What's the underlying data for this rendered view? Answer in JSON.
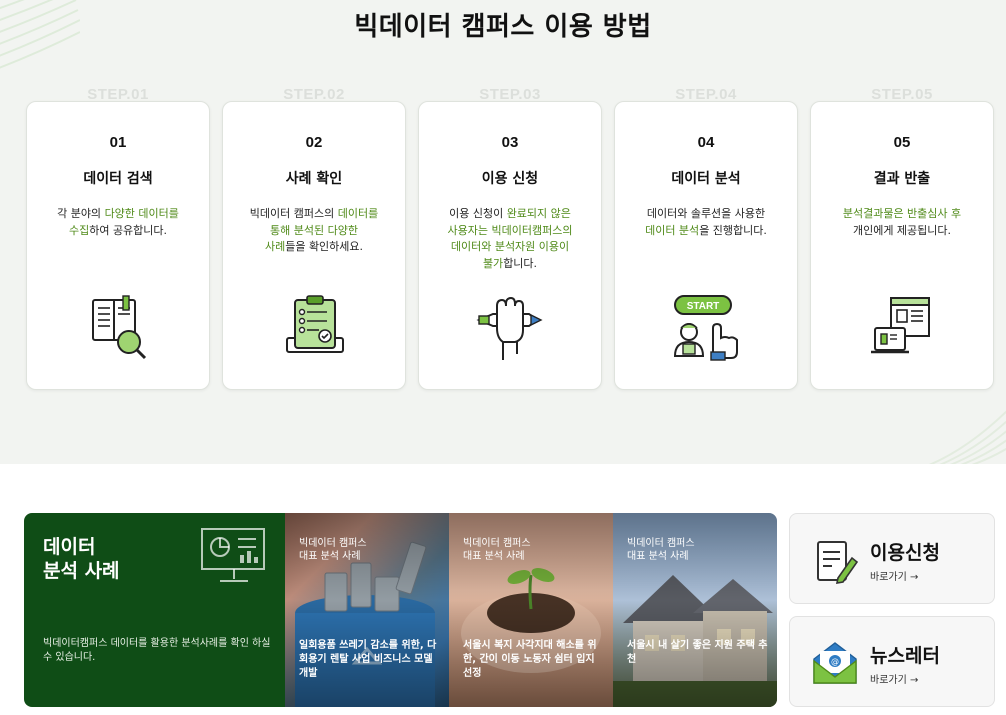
{
  "page": {
    "title": "빅데이터 캠퍼스 이용 방법"
  },
  "steps": [
    {
      "label": "STEP.01",
      "number": "01",
      "name": "데이터 검색",
      "icon": "book-search-icon",
      "desc": [
        [
          {
            "t": "각 분야의 "
          },
          {
            "t": "다양한 데이터를",
            "g": true
          }
        ],
        [
          {
            "t": "수집",
            "g": true
          },
          {
            "t": "하여 공유합니다."
          }
        ]
      ]
    },
    {
      "label": "STEP.02",
      "number": "02",
      "name": "사례 확인",
      "icon": "clipboard-checklist-icon",
      "desc": [
        [
          {
            "t": "빅데이터 캠퍼스의 "
          },
          {
            "t": "데이터를",
            "g": true
          }
        ],
        [
          {
            "t": "통해 분석된 다양한",
            "g": true
          }
        ],
        [
          {
            "t": "사례",
            "g": true
          },
          {
            "t": "들을 확인하세요."
          }
        ]
      ]
    },
    {
      "label": "STEP.03",
      "number": "03",
      "name": "이용 신청",
      "icon": "hand-pen-icon",
      "desc": [
        [
          {
            "t": "이용 신청이 "
          },
          {
            "t": "완료되지 않은",
            "g": true
          }
        ],
        [
          {
            "t": "사용자는 빅데이터캠퍼스의",
            "g": true
          }
        ],
        [
          {
            "t": "데이터와 분석자원 이용이",
            "g": true
          }
        ],
        [
          {
            "t": "불가",
            "g": true
          },
          {
            "t": "합니다."
          }
        ]
      ]
    },
    {
      "label": "STEP.04",
      "number": "04",
      "name": "데이터 분석",
      "icon": "start-click-icon",
      "icon_text": "START",
      "desc": [
        [
          {
            "t": "데이터와 솔루션을 사용한"
          }
        ],
        [
          {
            "t": "데이터 분석",
            "g": true
          },
          {
            "t": "을 진행합니다."
          }
        ]
      ]
    },
    {
      "label": "STEP.05",
      "number": "05",
      "name": "결과 반출",
      "icon": "monitor-export-icon",
      "desc": [
        [
          {
            "t": "분석결과물은 반출심사 후",
            "g": true
          }
        ],
        [
          {
            "t": "개인에게 제공됩니다."
          }
        ]
      ]
    }
  ],
  "cases": {
    "title": "데이터\n분석 사례",
    "icon": "dashboard-chart-icon",
    "description": "빅데이터캠퍼스 데이터를 활용한 분석사례를 확인 하실 수 있습니다.",
    "items": [
      {
        "label": "빅데이터 캠퍼스\n대표 분석 사례",
        "title": "일회용품 쓰레기 감소를 위한, 다회용기 렌탈 사업 비즈니스 모델 개발",
        "image": "recycling-cans-photo"
      },
      {
        "label": "빅데이터 캠퍼스\n대표 분석 사례",
        "title": "서울시 복지 사각지대 해소를 위한, 간이 이동 노동자 쉼터 입지 선정",
        "image": "sprout-hands-photo"
      },
      {
        "label": "빅데이터 캠퍼스\n대표 분석 사례",
        "title": "서울시 내 살기 좋은 지원 주택 추천",
        "image": "house-photo"
      }
    ]
  },
  "quick_links": [
    {
      "title": "이용신청",
      "link": "바로가기 →",
      "icon": "document-pen-icon"
    },
    {
      "title": "뉴스레터",
      "link": "바로가기 →",
      "icon": "email-envelope-icon"
    }
  ],
  "colors": {
    "accent_green": "#4f8a18",
    "dark_green": "#0f4d16",
    "section_bg": "#f2f4f1"
  }
}
